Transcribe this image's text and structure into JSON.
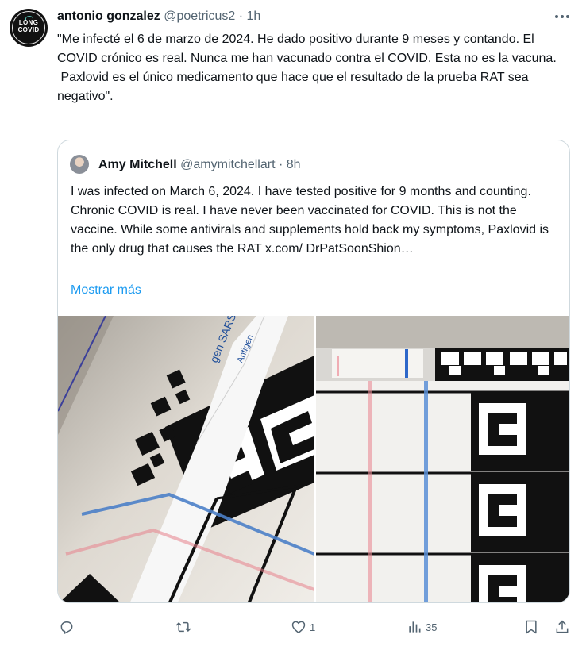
{
  "tweet": {
    "avatar": {
      "line1": "LONG",
      "line2": "COVID"
    },
    "author_name": "antonio gonzalez",
    "handle": "@poetricus2",
    "separator": "·",
    "time": "1h",
    "text": "\"Me infecté el 6 de marzo de 2024. He dado positivo durante 9 meses y contando. El COVID crónico es real. Nunca me han vacunado contra el COVID. Esta no es la vacuna.\n Paxlovid es el único medicamento que hace que el resultado de la prueba RAT sea negativo\"."
  },
  "quote": {
    "author_name": "Amy Mitchell",
    "handle": "@amymitchellart",
    "separator": "·",
    "time": "8h",
    "text": "I was infected on March 6, 2024. I have tested positive for 9 months and counting. Chronic COVID is real. I have never been vaccinated for COVID. This is not the vaccine. While some antivirals and supplements hold back my symptoms, Paxlovid is the only drug that causes the RAT  x.com/ DrPatSoonShion…",
    "show_more": "Mostrar más",
    "photos": [
      "rapid-antigen-test-photo-1",
      "rapid-antigen-test-photo-2"
    ],
    "photo_left_strip_text": "gen SARS",
    "photo_left_strip_text2": "Antigen"
  },
  "actions": {
    "reply": {
      "icon": "reply-icon",
      "count": ""
    },
    "repost": {
      "icon": "repost-icon",
      "count": ""
    },
    "like": {
      "icon": "like-icon",
      "count": "1"
    },
    "views": {
      "icon": "views-icon",
      "count": "35"
    },
    "bookmark": {
      "icon": "bookmark-icon",
      "count": ""
    },
    "share": {
      "icon": "share-icon",
      "count": ""
    }
  },
  "colors": {
    "link": "#1d9bf0",
    "muted": "#536471",
    "text": "#0f1419",
    "border": "#cfd9de"
  }
}
